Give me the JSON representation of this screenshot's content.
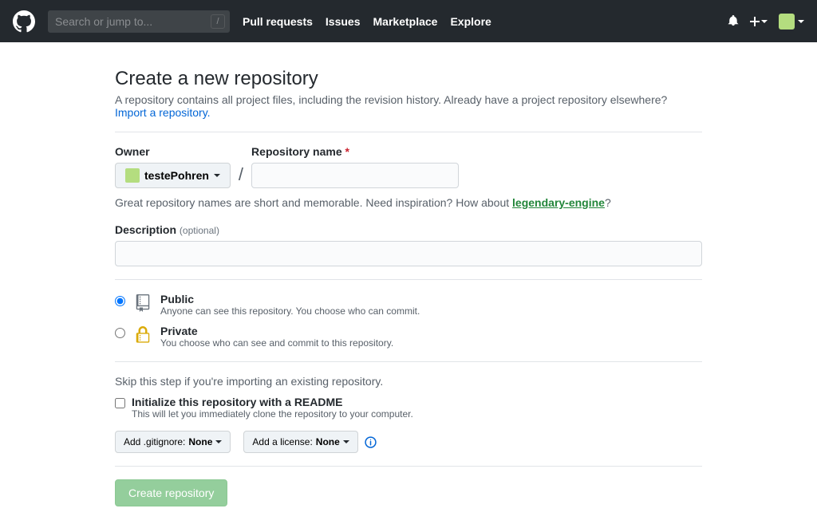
{
  "header": {
    "search_placeholder": "Search or jump to...",
    "nav": {
      "pull_requests": "Pull requests",
      "issues": "Issues",
      "marketplace": "Marketplace",
      "explore": "Explore"
    }
  },
  "page": {
    "title": "Create a new repository",
    "subhead": "A repository contains all project files, including the revision history. Already have a project repository elsewhere?",
    "import_link": "Import a repository.",
    "owner_label": "Owner",
    "owner_value": "testePohren",
    "repo_name_label": "Repository name",
    "name_hint_pre": "Great repository names are short and memorable. Need inspiration? How about ",
    "name_hint_suggestion": "legendary-engine",
    "name_hint_post": "?",
    "description_label": "Description",
    "optional_text": "(optional)",
    "visibility": {
      "public_title": "Public",
      "public_desc": "Anyone can see this repository. You choose who can commit.",
      "private_title": "Private",
      "private_desc": "You choose who can see and commit to this repository."
    },
    "skip_note": "Skip this step if you're importing an existing repository.",
    "readme_title": "Initialize this repository with a README",
    "readme_desc": "This will let you immediately clone the repository to your computer.",
    "gitignore_pre": "Add .gitignore: ",
    "gitignore_val": "None",
    "license_pre": "Add a license: ",
    "license_val": "None",
    "submit": "Create repository"
  }
}
